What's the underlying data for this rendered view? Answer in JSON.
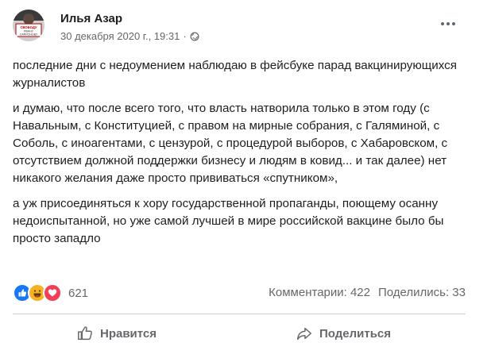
{
  "post": {
    "author": "Илья Азар",
    "timestamp": "30 декабря 2020 г., 19:31",
    "separator": "·",
    "avatar_text": {
      "line1": "СВОБОДУ",
      "line2": "ИВАНУ",
      "line3": "САФРОНОВУ"
    },
    "paragraphs": [
      "последние дни с недоумением наблюдаю в фейсбуке парад вакцинирующихся журналистов",
      "и думаю, что после всего того, что власть натворила только в этом году (с Навальным, с Конституцией, с правом на мирные собрания, с Галяминой, с Соболь, с иноагентами, с цензурой, с процедурой выборов, с Хабаровском, с отсутствием должной поддержки бизнесу и людям в ковид... и так далее) нет никакого желания даже просто прививаться «спутником»,",
      "а уж присоединяться к хору государственной пропаганды, поющему осанну недоиспытанной, но уже самой лучшей в мире российской вакцине было бы просто западло"
    ]
  },
  "stats": {
    "reaction_count": "621",
    "comments": "Комментарии: 422",
    "shares": "Поделились: 33",
    "reaction_icons": [
      "like-icon",
      "haha-icon",
      "love-icon"
    ]
  },
  "actions": {
    "like_label": "Нравится",
    "share_label": "Поделиться"
  },
  "colors": {
    "secondary_text": "#65676b",
    "like_blue": "#1877f2",
    "haha_yellow": "#f7b125",
    "love_red": "#f33e58"
  }
}
